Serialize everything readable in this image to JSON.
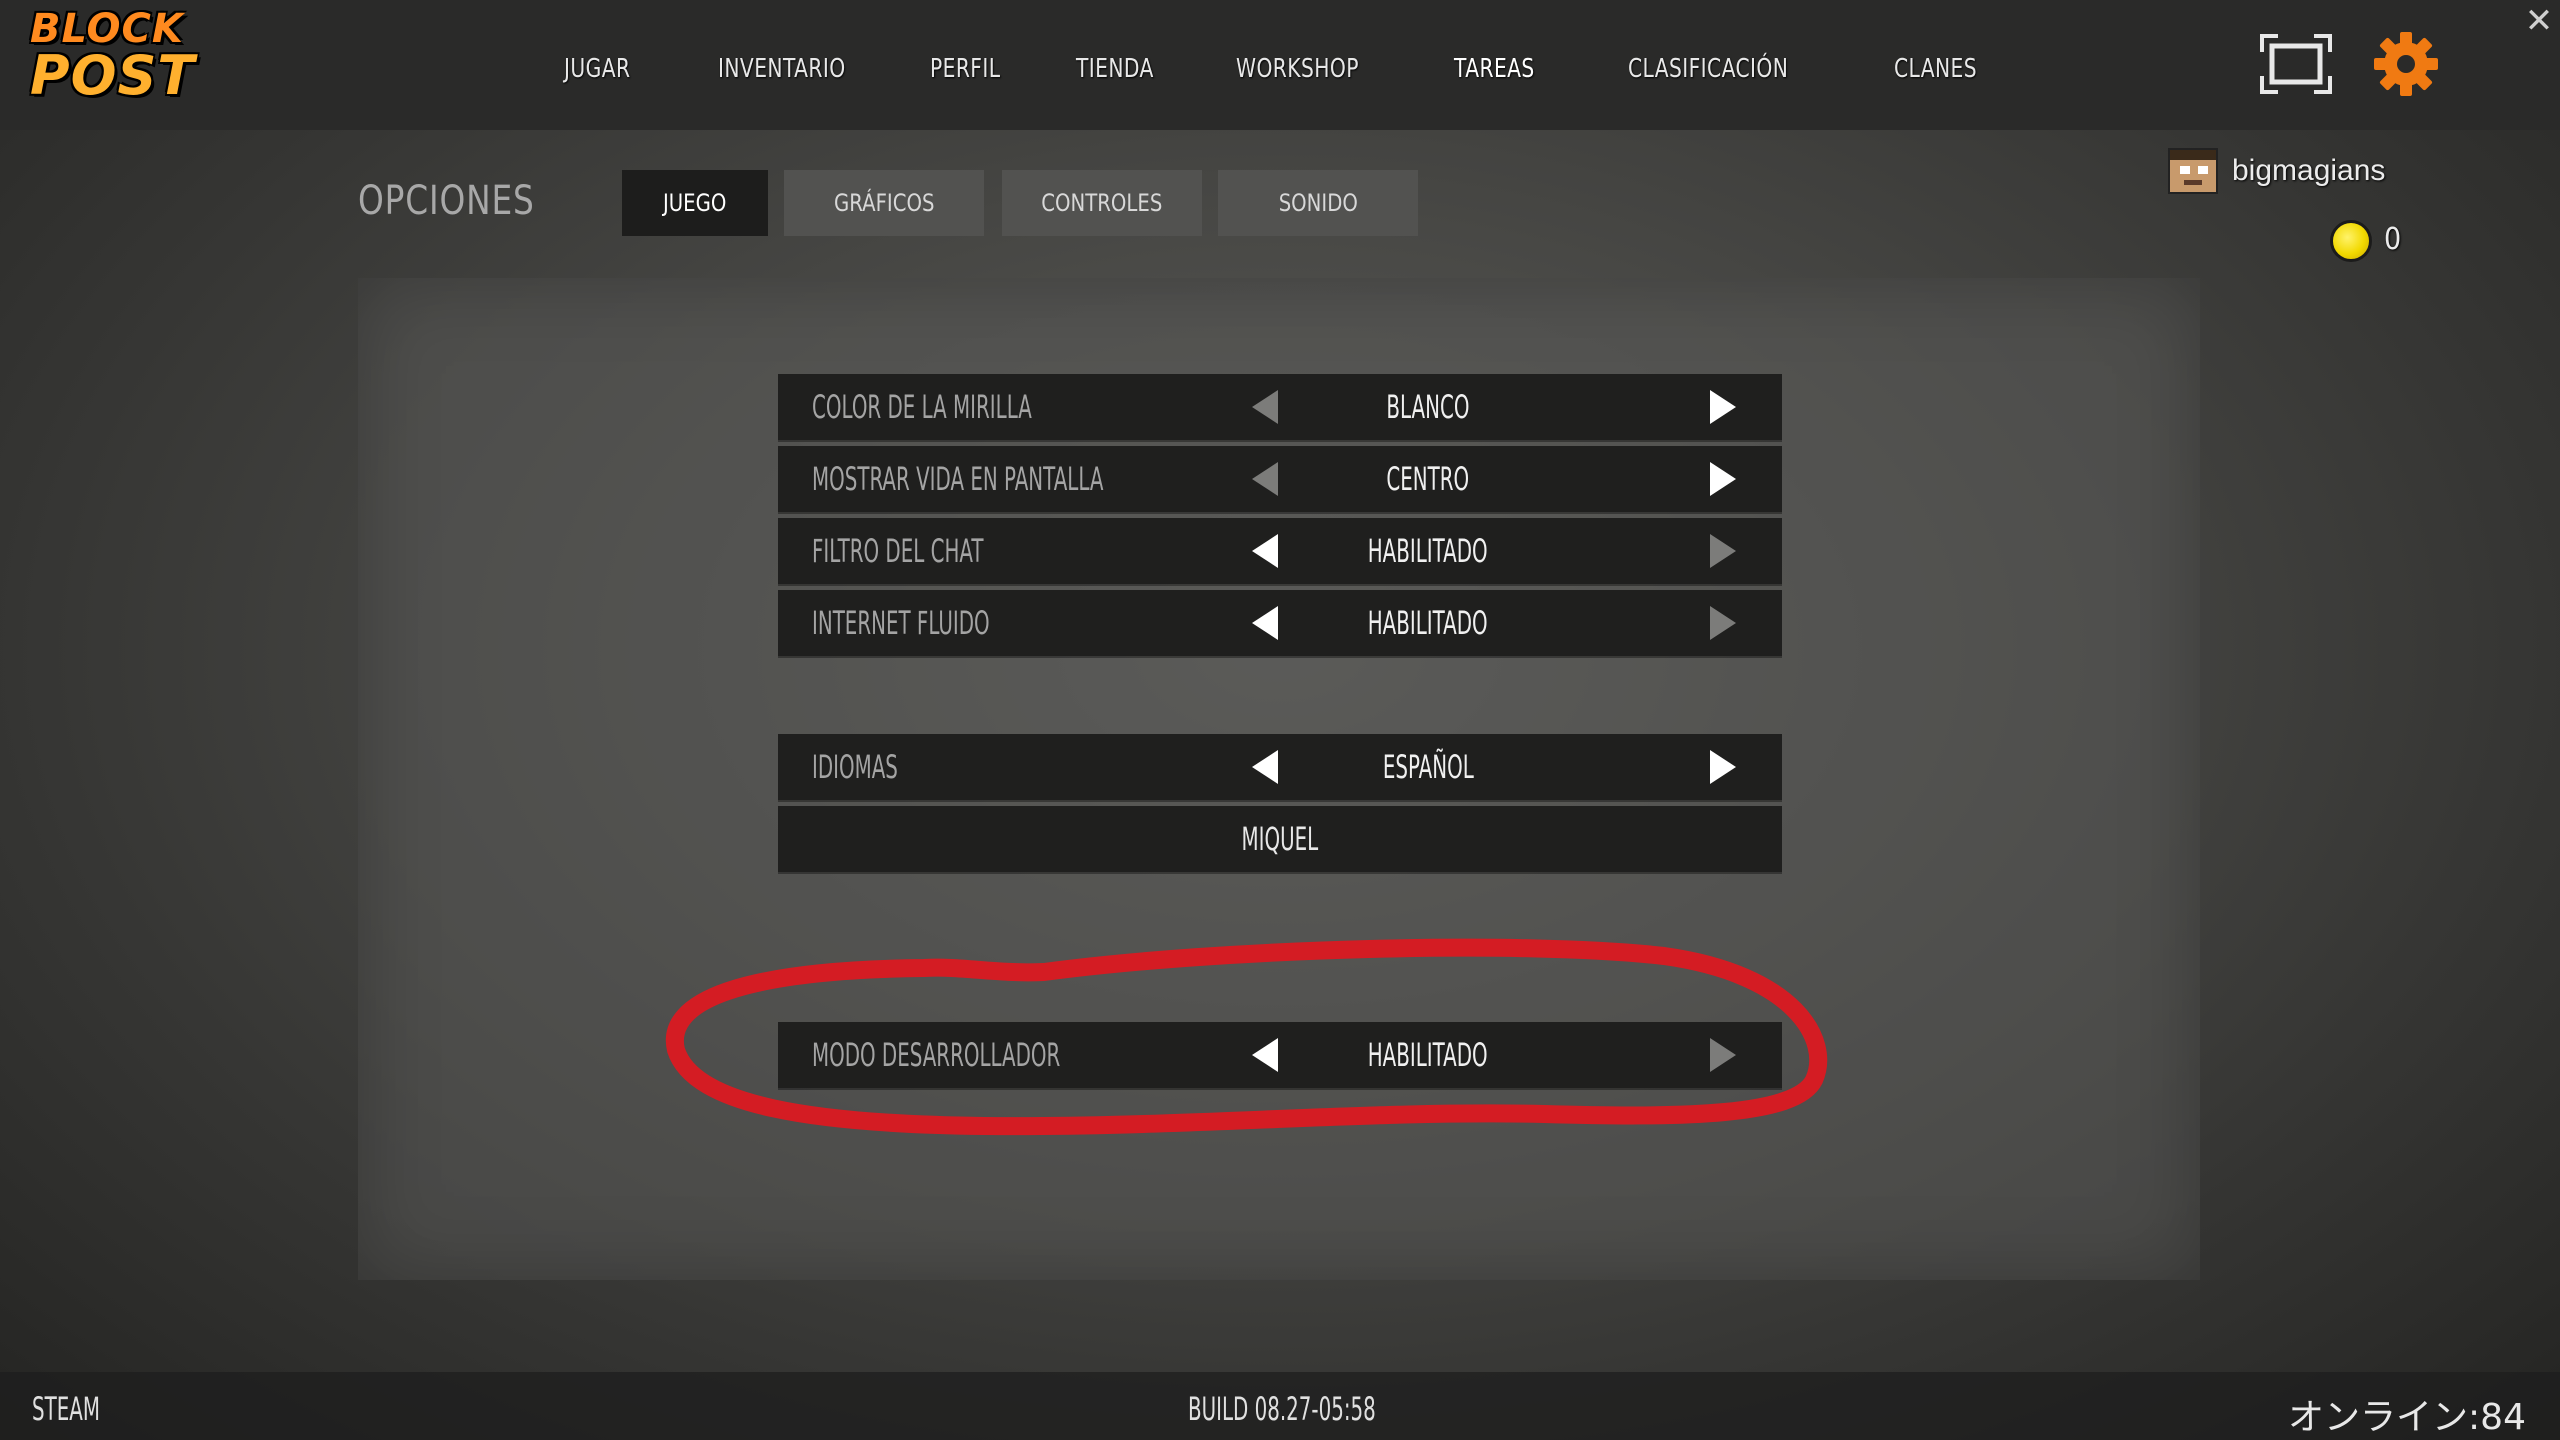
{
  "logo": {
    "line1": "BLOCK",
    "line2": "POST"
  },
  "nav": {
    "items": [
      {
        "label": "JUGAR"
      },
      {
        "label": "INVENTARIO"
      },
      {
        "label": "PERFIL"
      },
      {
        "label": "TIENDA"
      },
      {
        "label": "WORKSHOP"
      },
      {
        "label": "TAREAS"
      },
      {
        "label": "CLASIFICACIÓN"
      },
      {
        "label": "CLANES"
      }
    ],
    "icons": {
      "fullscreen": "fullscreen-icon",
      "settings": "gear-icon",
      "close": "close-icon"
    },
    "close_glyph": "✕"
  },
  "user": {
    "name": "bigmagians",
    "coins": "0"
  },
  "options": {
    "title": "OPCIONES",
    "tabs": [
      {
        "label": "JUEGO",
        "active": true
      },
      {
        "label": "GRÁFICOS",
        "active": false
      },
      {
        "label": "CONTROLES",
        "active": false
      },
      {
        "label": "SONIDO",
        "active": false
      }
    ],
    "settings": [
      {
        "label": "COLOR DE LA MIRILLA",
        "value": "BLANCO"
      },
      {
        "label": "MOSTRAR VIDA EN PANTALLA",
        "value": "CENTRO"
      },
      {
        "label": "FILTRO DEL CHAT",
        "value": "HABILITADO"
      },
      {
        "label": "INTERNET FLUIDO",
        "value": "HABILITADO"
      }
    ],
    "language": {
      "label": "IDIOMAS",
      "value": "ESPAÑOL",
      "credit": "MIQUEL"
    },
    "developer": {
      "label": "MODO DESARROLLADOR",
      "value": "HABILITADO"
    }
  },
  "footer": {
    "platform": "STEAM",
    "build": "BUILD 08.27-05:58",
    "online": "オンライン:84"
  },
  "colors": {
    "accent": "#ff8a1f",
    "gear": "#f07a12",
    "coin": "#f2d900",
    "annotation": "#e01820"
  }
}
